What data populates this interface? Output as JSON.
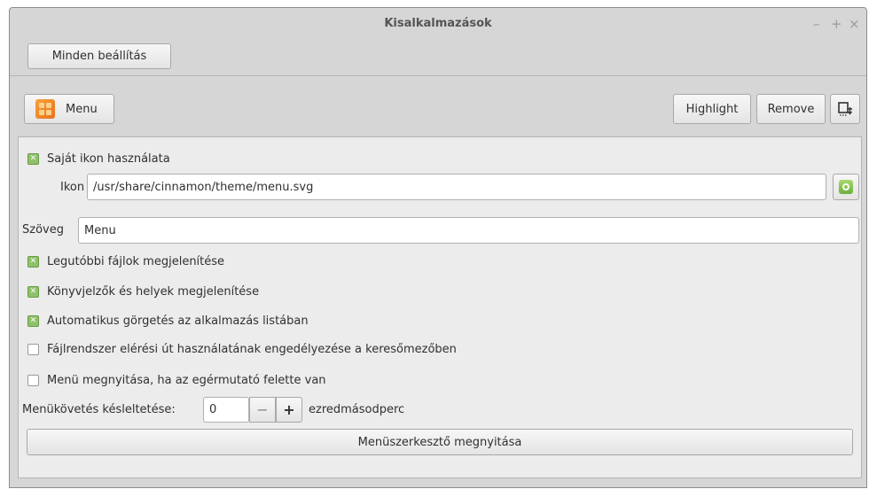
{
  "window": {
    "title": "Kisalkalmazások",
    "minimize": "–",
    "maximize": "+",
    "close": "×"
  },
  "toolbar": {
    "all_settings": "Minden beállítás"
  },
  "applet_bar": {
    "applet_name": "Menu",
    "highlight": "Highlight",
    "remove": "Remove",
    "applet_icon": "menu-grid-icon",
    "export_icon": "export-icon"
  },
  "settings": {
    "use_custom_icon": {
      "label": "Saját ikon használata",
      "checked": true
    },
    "icon": {
      "label": "Ikon",
      "value": "/usr/share/cinnamon/theme/menu.svg",
      "browse_icon": "image-chooser-icon"
    },
    "text": {
      "label": "Szöveg",
      "value": "Menu"
    },
    "show_recent": {
      "label": "Legutóbbi fájlok megjelenítése",
      "checked": true
    },
    "show_bookmarks": {
      "label": "Könyvjelzők és helyek megjelenítése",
      "checked": true
    },
    "autoscroll": {
      "label": "Automatikus görgetés az alkalmazás listában",
      "checked": true
    },
    "filesystem_path": {
      "label": "Fájlrendszer elérési út használatának engedélyezése a keresőmezőben",
      "checked": false
    },
    "open_on_hover": {
      "label": "Menü megnyitása, ha az egérmutató felette van",
      "checked": false
    },
    "hover_delay": {
      "label": "Menükövetés késleltetése:",
      "value": "0",
      "minus": "−",
      "plus": "+",
      "unit": "ezredmásodperc"
    },
    "open_editor": {
      "label": "Menüszerkesztő megnyitása"
    }
  },
  "checkmark": "✕"
}
